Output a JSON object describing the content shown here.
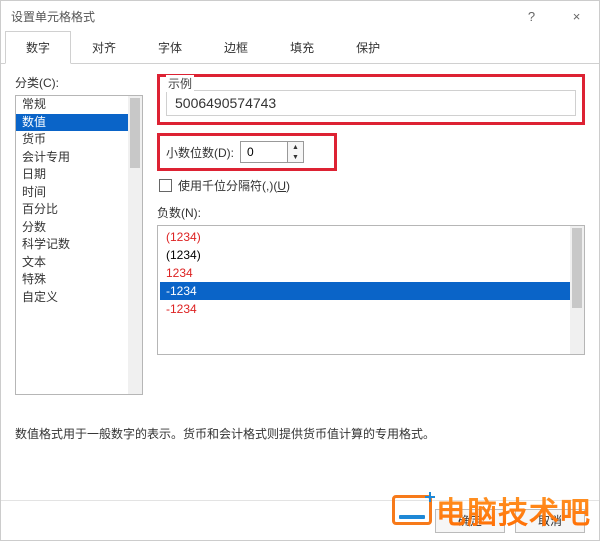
{
  "window": {
    "title": "设置单元格格式"
  },
  "titlebar": {
    "help": "?",
    "close": "×"
  },
  "tabs": [
    "数字",
    "对齐",
    "字体",
    "边框",
    "填充",
    "保护"
  ],
  "active_tab": 0,
  "category": {
    "label": "分类(C):",
    "items": [
      "常规",
      "数值",
      "货币",
      "会计专用",
      "日期",
      "时间",
      "百分比",
      "分数",
      "科学记数",
      "文本",
      "特殊",
      "自定义"
    ],
    "selected_index": 1
  },
  "sample": {
    "label": "示例",
    "value": "5006490574743"
  },
  "decimal": {
    "label": "小数位数(D):",
    "value": "0"
  },
  "thousand_sep": {
    "label_prefix": "使用千位分隔符(,)(",
    "hotkey": "U",
    "label_suffix": ")",
    "checked": false
  },
  "negative": {
    "label": "负数(N):",
    "items": [
      {
        "text": "(1234)",
        "color": "red"
      },
      {
        "text": "(1234)",
        "color": "black"
      },
      {
        "text": "1234",
        "color": "red"
      },
      {
        "text": "-1234",
        "color": "white",
        "selected": true
      },
      {
        "text": "-1234",
        "color": "red"
      }
    ]
  },
  "description": "数值格式用于一般数字的表示。货币和会计格式则提供货币值计算的专用格式。",
  "footer": {
    "ok": "确定",
    "cancel": "取消"
  },
  "watermark": {
    "text": "电脑技术吧"
  }
}
